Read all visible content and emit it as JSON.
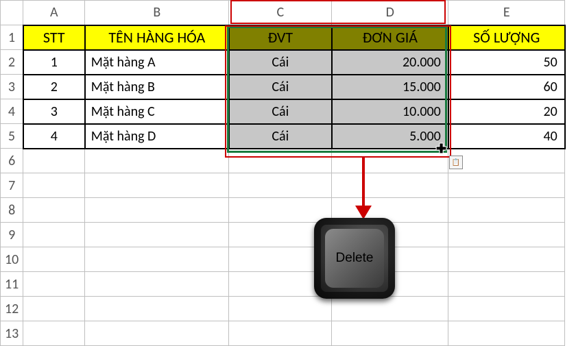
{
  "columns": [
    "A",
    "B",
    "C",
    "D",
    "E"
  ],
  "rows": [
    "1",
    "2",
    "3",
    "4",
    "5",
    "6",
    "7",
    "8",
    "9",
    "10",
    "11",
    "12",
    "13"
  ],
  "headers": {
    "stt": "STT",
    "ten": "TÊN HÀNG HÓA",
    "dvt": "ĐVT",
    "dongia": "ĐƠN GIÁ",
    "soluong": "SỐ LƯỢNG"
  },
  "data": [
    {
      "stt": "1",
      "ten": "Mặt hàng A",
      "dvt": "Cái",
      "dongia": "20.000",
      "soluong": "50"
    },
    {
      "stt": "2",
      "ten": "Mặt hàng B",
      "dvt": "Cái",
      "dongia": "15.000",
      "soluong": "60"
    },
    {
      "stt": "3",
      "ten": "Mặt hàng C",
      "dvt": "Cái",
      "dongia": "10.000",
      "soluong": "20"
    },
    {
      "stt": "4",
      "ten": "Mặt hàng D",
      "dvt": "Cái",
      "dongia": "5.000",
      "soluong": "40"
    }
  ],
  "key_label": "Delete",
  "chart_data": {
    "type": "table",
    "columns": [
      "STT",
      "TÊN HÀNG HÓA",
      "ĐVT",
      "ĐƠN GIÁ",
      "SỐ LƯỢNG"
    ],
    "rows": [
      [
        "1",
        "Mặt hàng A",
        "Cái",
        "20.000",
        "50"
      ],
      [
        "2",
        "Mặt hàng B",
        "Cái",
        "15.000",
        "60"
      ],
      [
        "3",
        "Mặt hàng C",
        "Cái",
        "10.000",
        "20"
      ],
      [
        "4",
        "Mặt hàng D",
        "Cái",
        "5.000",
        "40"
      ]
    ],
    "selected_range": "C1:D5",
    "action_hint": "Delete"
  }
}
